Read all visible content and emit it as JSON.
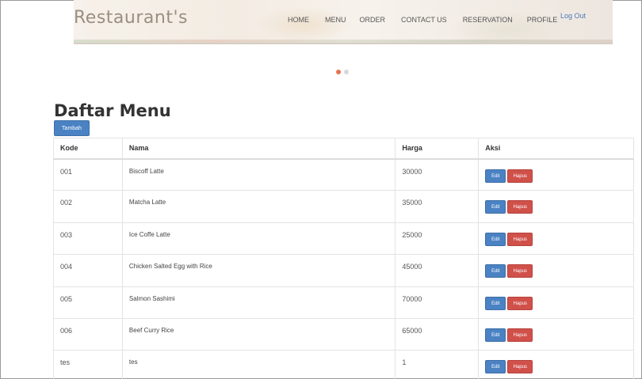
{
  "brand": "Restaurant's",
  "nav": [
    "HOME",
    "MENU",
    "ORDER",
    "CONTACT US",
    "RESERVATION",
    "PROFILE"
  ],
  "logout": "Log Out",
  "carousel": {
    "count": 2,
    "active": 0,
    "active_color": "#e8734f"
  },
  "page_title": "Daftar Menu",
  "add_button": "Tambah",
  "table": {
    "headers": [
      "Kode",
      "Nama",
      "Harga",
      "Aksi"
    ],
    "rows": [
      {
        "kode": "001",
        "nama": "Biscoff Latte",
        "harga": "30000"
      },
      {
        "kode": "002",
        "nama": "Matcha Latte",
        "harga": "35000"
      },
      {
        "kode": "003",
        "nama": "Ice Coffe Latte",
        "harga": "25000"
      },
      {
        "kode": "004",
        "nama": "Chicken Salted Egg with Rice",
        "harga": "45000"
      },
      {
        "kode": "005",
        "nama": "Salmon Sashimi",
        "harga": "70000"
      },
      {
        "kode": "006",
        "nama": "Beef Curry Rice",
        "harga": "65000"
      },
      {
        "kode": "tes",
        "nama": "tes",
        "harga": "1"
      }
    ],
    "edit_label": "Edit",
    "delete_label": "Hapus"
  },
  "colors": {
    "primary": "#4a82c3",
    "danger": "#d0504a",
    "brand": "#9a8f80"
  }
}
